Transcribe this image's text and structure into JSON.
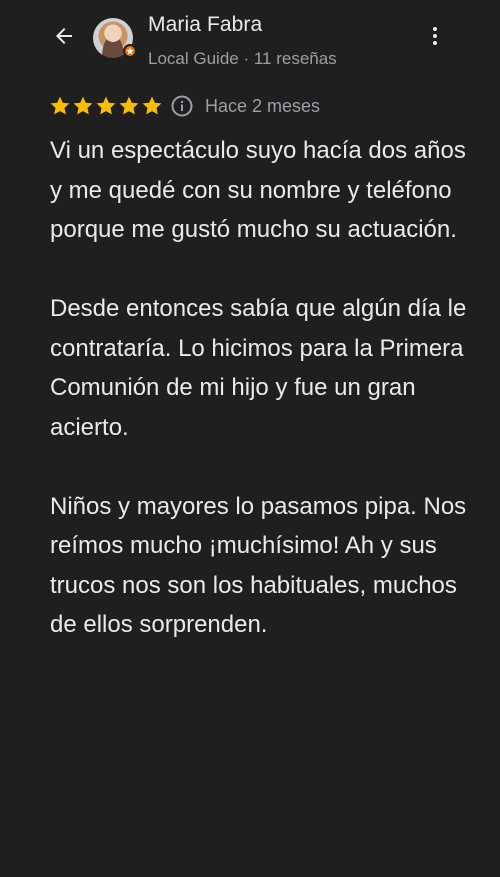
{
  "header": {
    "back_icon": "arrow-back-icon",
    "reviewer_name": "Maria Fabra",
    "reviewer_subtitle": "Local Guide · 11 reseñas",
    "avatar_badge_icon": "local-guide-badge-icon",
    "more_icon": "more-vert-icon"
  },
  "review": {
    "rating": 5,
    "max_rating": 5,
    "star_color": "#fbbc04",
    "info_icon": "info-icon",
    "time_ago": "Hace 2 meses",
    "paragraphs": [
      "Vi un espectáculo suyo hacía dos años y me quedé con su nombre y teléfono porque me gustó mucho su actuación.",
      "Desde entonces sabía que algún día le contrataría. Lo hicimos para la Primera Comunión de mi hijo y fue un gran acierto.",
      "Niños y mayores lo pasamos pipa. Nos reímos mucho ¡muchísimo! Ah y sus trucos nos son los habituales, muchos de ellos sorprenden."
    ]
  },
  "colors": {
    "background": "#1f1f1f",
    "primary_text": "#e8eaed",
    "secondary_text": "#9aa0a6",
    "badge": "#e8710a"
  }
}
